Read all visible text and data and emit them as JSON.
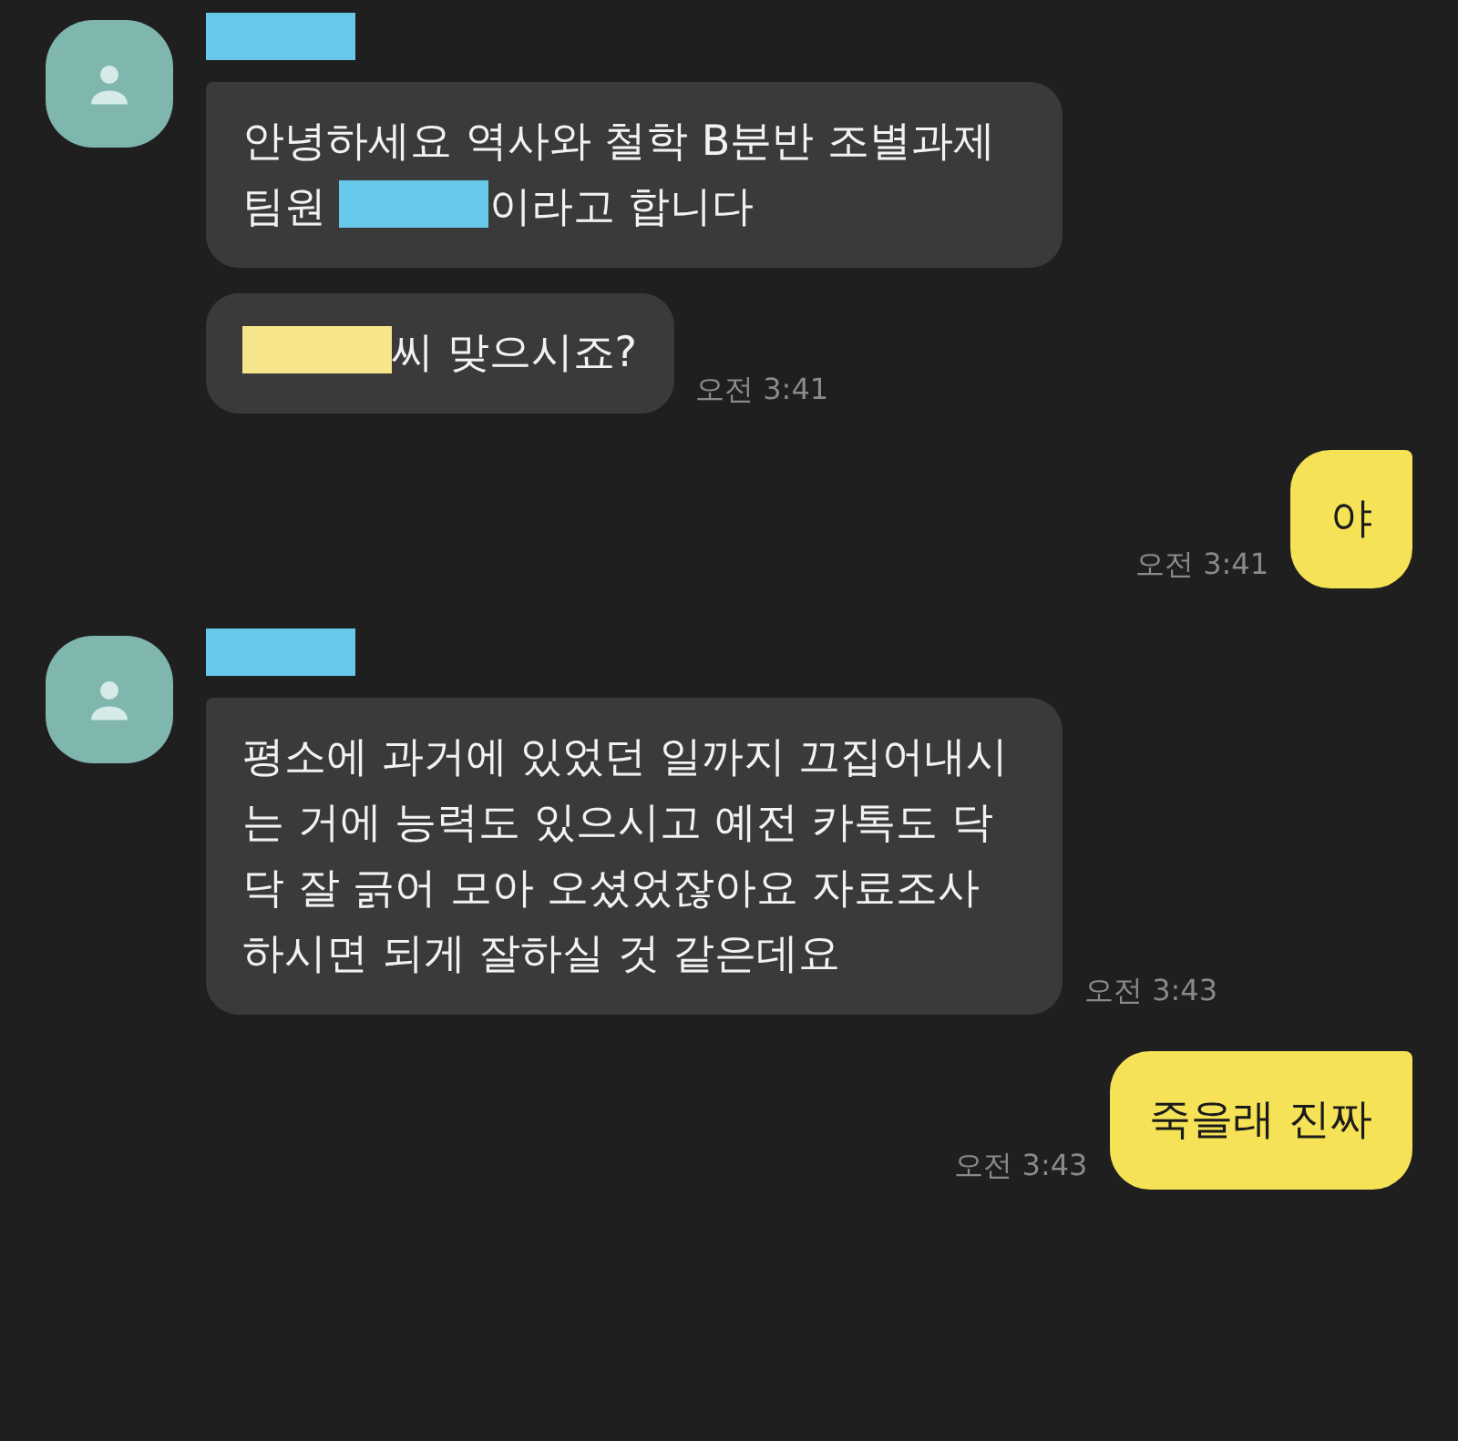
{
  "chat": [
    {
      "kind": "received",
      "sender": {
        "kind": "redaction",
        "color": "#66c9ea"
      },
      "messages": [
        {
          "parts": [
            {
              "kind": "text",
              "text": "안녕하세요 역사와 철학 B분반 조별과제 팀원 "
            },
            {
              "kind": "redaction",
              "color": "#66c9ea"
            },
            {
              "kind": "text",
              "text": "이라고 합니다"
            }
          ]
        },
        {
          "parts": [
            {
              "kind": "redaction",
              "color": "#f6e58a"
            },
            {
              "kind": "text",
              "text": "씨 맞으시죠?"
            }
          ],
          "time": "오전 3:41"
        }
      ]
    },
    {
      "kind": "sent",
      "messages": [
        {
          "parts": [
            {
              "kind": "text",
              "text": "야"
            }
          ],
          "time": "오전 3:41"
        }
      ]
    },
    {
      "kind": "received",
      "sender": {
        "kind": "redaction",
        "color": "#66c9ea"
      },
      "messages": [
        {
          "parts": [
            {
              "kind": "text",
              "text": "평소에 과거에 있었던 일까지 끄집어내시는 거에 능력도 있으시고 예전 카톡도 닥닥 잘 긁어 모아 오셨었잖아요 자료조사 하시면 되게 잘하실 것 같은데요"
            }
          ],
          "time": "오전 3:43"
        }
      ]
    },
    {
      "kind": "sent",
      "messages": [
        {
          "parts": [
            {
              "kind": "text",
              "text": "죽을래 진짜"
            }
          ],
          "time": "오전 3:43"
        }
      ]
    }
  ]
}
